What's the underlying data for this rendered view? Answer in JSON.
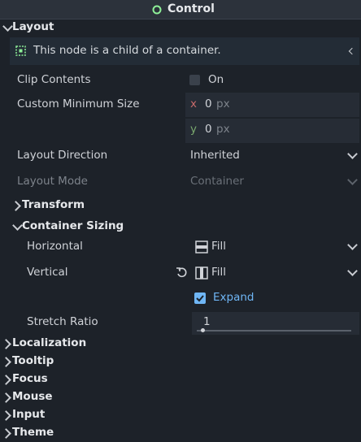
{
  "header": {
    "title": "Control",
    "icon": "circle-outline-icon",
    "accent": "#8eef97"
  },
  "layout_section": {
    "label": "Layout",
    "info": "This node is a child of a container.",
    "clip_contents": {
      "label": "Clip Contents",
      "value": "On",
      "checked": false
    },
    "custom_min_size": {
      "label": "Custom Minimum Size",
      "x_label": "x",
      "x_value": "0",
      "y_label": "y",
      "y_value": "0",
      "unit": "px"
    },
    "layout_direction": {
      "label": "Layout Direction",
      "value": "Inherited"
    },
    "layout_mode": {
      "label": "Layout Mode",
      "value": "Container"
    }
  },
  "transform": {
    "label": "Transform"
  },
  "container_sizing": {
    "label": "Container Sizing",
    "horizontal": {
      "label": "Horizontal",
      "value": "Fill"
    },
    "vertical": {
      "label": "Vertical",
      "value": "Fill",
      "expand_label": "Expand",
      "expand_checked": true
    },
    "stretch_ratio": {
      "label": "Stretch Ratio",
      "value": "1"
    }
  },
  "sections": [
    "Localization",
    "Tooltip",
    "Focus",
    "Mouse",
    "Input",
    "Theme"
  ],
  "colors": {
    "axis_x": "#c76a6a",
    "axis_y": "#7aa86e",
    "expand_accent": "#6fb6f5"
  }
}
